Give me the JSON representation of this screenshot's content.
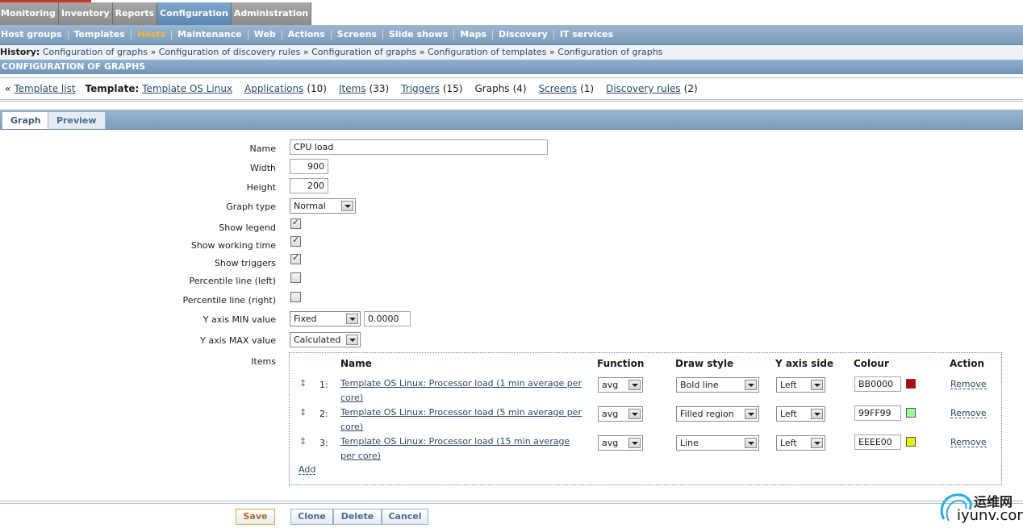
{
  "main_menu": [
    "Monitoring",
    "Inventory",
    "Reports",
    "Configuration",
    "Administration"
  ],
  "sub_menu": [
    "Host groups",
    "Templates",
    "Hosts",
    "Maintenance",
    "Web",
    "Actions",
    "Screens",
    "Slide shows",
    "Maps",
    "Discovery",
    "IT services"
  ],
  "history": {
    "label": "History:",
    "items": [
      "Configuration of graphs",
      "Configuration of discovery rules",
      "Configuration of graphs",
      "Configuration of templates",
      "Configuration of graphs"
    ],
    "separator": "»"
  },
  "page_header": "CONFIGURATION OF GRAPHS",
  "navbar": {
    "back_prefix": "«",
    "template_list": "Template list",
    "template_label": "Template:",
    "template_name": "Template OS Linux",
    "applications": "Applications",
    "applications_count": "(10)",
    "items": "Items",
    "items_count": "(33)",
    "triggers": "Triggers",
    "triggers_count": "(15)",
    "graphs": "Graphs",
    "graphs_count": "(4)",
    "screens": "Screens",
    "screens_count": "(1)",
    "discovery_rules": "Discovery rules",
    "discovery_rules_count": "(2)"
  },
  "tabs": {
    "graph": "Graph",
    "preview": "Preview"
  },
  "form": {
    "name_label": "Name",
    "name_value": "CPU load",
    "width_label": "Width",
    "width_value": "900",
    "height_label": "Height",
    "height_value": "200",
    "graph_type_label": "Graph type",
    "graph_type_value": "Normal",
    "show_legend_label": "Show legend",
    "show_legend": true,
    "show_working_time_label": "Show working time",
    "show_working_time": true,
    "show_triggers_label": "Show triggers",
    "show_triggers": true,
    "percentile_left_label": "Percentile line (left)",
    "percentile_left": false,
    "percentile_right_label": "Percentile line (right)",
    "percentile_right": false,
    "ymin_label": "Y axis MIN value",
    "ymin_type": "Fixed",
    "ymin_value": "0.0000",
    "ymax_label": "Y axis MAX value",
    "ymax_type": "Calculated",
    "items_label": "Items"
  },
  "items_table": {
    "headers": {
      "name": "Name",
      "function": "Function",
      "draw_style": "Draw style",
      "y_axis_side": "Y axis side",
      "colour": "Colour",
      "action": "Action"
    },
    "handle_icon": "↕",
    "rows": [
      {
        "num": "1:",
        "name": "Template OS Linux: Processor load (1 min average per core)",
        "function": "avg",
        "draw_style": "Bold line",
        "y_axis_side": "Left",
        "colour": "BB0000",
        "colour_hex": "#BB0000",
        "action": "Remove"
      },
      {
        "num": "2:",
        "name": "Template OS Linux: Processor load (5 min average per core)",
        "function": "avg",
        "draw_style": "Filled region",
        "y_axis_side": "Left",
        "colour": "99FF99",
        "colour_hex": "#99FF99",
        "action": "Remove"
      },
      {
        "num": "3:",
        "name": "Template OS Linux: Processor load (15 min average per core)",
        "function": "avg",
        "draw_style": "Line",
        "y_axis_side": "Left",
        "colour": "EEEE00",
        "colour_hex": "#EEEE00",
        "action": "Remove"
      }
    ],
    "add": "Add"
  },
  "buttons": {
    "save": "Save",
    "clone": "Clone",
    "delete": "Delete",
    "cancel": "Cancel"
  },
  "watermark": {
    "cn": "运维网",
    "en": "iyunv.com"
  },
  "colors": {
    "header_blue": "#7b9cbc",
    "accent_orange": "#f5b73a",
    "top_red": "#c0392b"
  }
}
